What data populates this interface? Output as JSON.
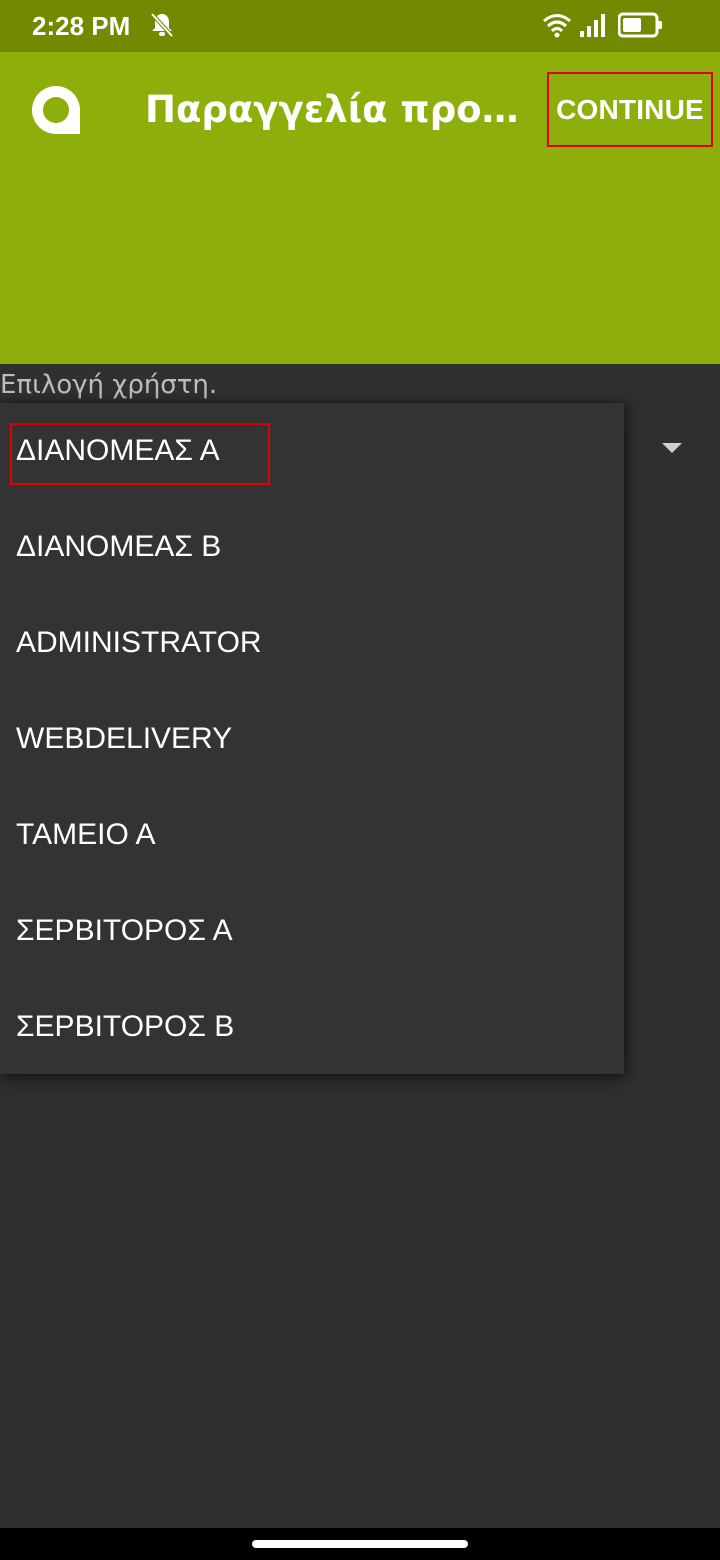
{
  "status_bar": {
    "time": "2:28 PM",
    "icons": [
      "bell-off-icon",
      "wifi-icon",
      "signal-icon",
      "battery-icon"
    ],
    "background": "#728a00"
  },
  "app_bar": {
    "title": "Παραγγελία προσωπικού",
    "continue_label": "CONTINUE",
    "logo_icon": "app-logo-icon",
    "background": "#8eaf0b"
  },
  "content": {
    "prompt_label": "Επιλογή χρήστη.",
    "dropdown_arrow_icon": "dropdown-arrow-icon"
  },
  "dropdown": {
    "selected_index": 0,
    "items": [
      {
        "label": "ΔΙΑΝΟΜΕΑΣ Α"
      },
      {
        "label": "ΔΙΑΝΟΜΕΑΣ Β"
      },
      {
        "label": "ADMINISTRATOR"
      },
      {
        "label": "WEBDELIVERY"
      },
      {
        "label": "ΤΑΜΕΙΟ Α"
      },
      {
        "label": "ΣΕΡΒΙΤΟΡΟΣ Α"
      },
      {
        "label": "ΣΕΡΒΙΤΟΡΟΣ Β"
      }
    ]
  },
  "colors": {
    "highlight": "#e00000",
    "background": "#303030"
  }
}
